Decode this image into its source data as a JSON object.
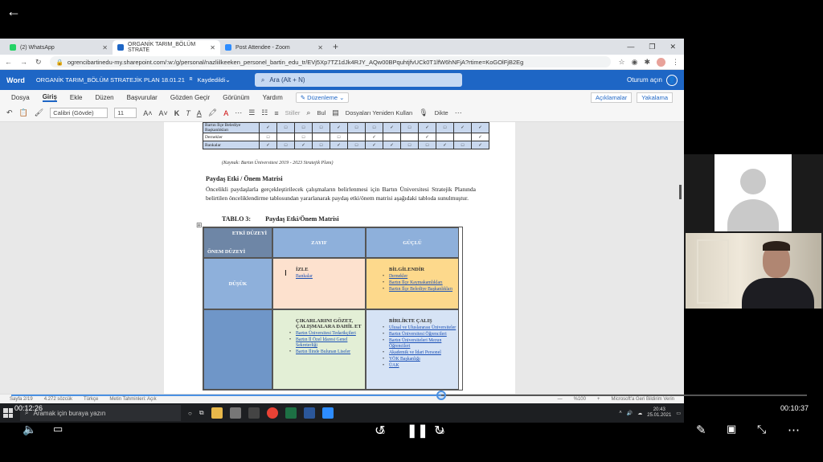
{
  "browser": {
    "tabs": [
      {
        "label": "(2) WhatsApp",
        "color": "#25d366",
        "active": false
      },
      {
        "label": "ORGANİK TARIM_BÖLÜM STRATE",
        "color": "#1e66c5",
        "active": true
      },
      {
        "label": "Post Attendee - Zoom",
        "color": "#2d8cff",
        "active": false
      }
    ],
    "url": "ogrencibartinedu-my.sharepoint.com/:w:/g/personal/nazliilkeeken_personel_bartin_edu_tr/EVj5Xp7TZ1dJk4RJY_AQw00BPquhtjfvUCk0T1lfW6hNFjA?rtime=KoGOlFjB2Eg"
  },
  "word": {
    "app_name": "Word",
    "doc_title": "ORGANİK TARIM_BÖLÜM STRATEJİK PLAN 18.01.21",
    "saved": "Kaydedildi",
    "search_placeholder": "Ara (Alt + N)",
    "signin": "Oturum açın",
    "ribbon_tabs": [
      "Dosya",
      "Giriş",
      "Ekle",
      "Düzen",
      "Başvurular",
      "Gözden Geçir",
      "Görünüm",
      "Yardım"
    ],
    "edit_mode": "Düzenleme",
    "comments": "Açıklamalar",
    "catchup": "Yakalama",
    "font": "Calibri (Gövde)",
    "font_size": "11",
    "styles": "Stiller",
    "find": "Bul",
    "reuse": "Dosyaları Yeniden Kullan",
    "dictate": "Dikte"
  },
  "document": {
    "top_rows": [
      {
        "label": "Bartın İlçe Belediye Başkanlıkları",
        "cells": [
          "✓",
          "□",
          "□",
          "□",
          "✓",
          "□",
          "□",
          "✓",
          "□",
          "✓",
          "□",
          "✓",
          "✓"
        ]
      },
      {
        "label": "Dernekler",
        "cells": [
          "□",
          "",
          "□",
          "",
          "□",
          "",
          "✓",
          "",
          "",
          "✓",
          "",
          "",
          "✓"
        ]
      },
      {
        "label": "Bankalar",
        "cells": [
          "✓",
          "□",
          "✓",
          "□",
          "✓",
          "□",
          "✓",
          "✓",
          "□",
          "□",
          "✓",
          "□",
          "✓"
        ]
      }
    ],
    "caption": "(Kaynak: Bartın Üniversitesi 2019 - 2023 Stratejik Planı)",
    "heading": "Paydaş Etki / Önem Matrisi",
    "paragraph": "Öncelikli paydaşlarla gerçekleştirilecek çalışmaların belirlenmesi için Bartın Üniversitesi Stratejik Planında belirtilen önceliklendirme tablosundan yararlanarak paydaş etki/önem matrisi aşağıdaki tabloda sunulmuştur.",
    "table_no": "TABLO 3:",
    "table_title": "Paydaş Etki/Önem Matrisi",
    "matrix": {
      "corner_top": "ETKİ DÜZEYİ",
      "corner_bottom": "ÖNEM DÜZEYİ",
      "col1": "ZAYIF",
      "col2": "GÜÇLÜ",
      "row1": "DÜŞÜK",
      "q11_title": "İZLE",
      "q11_items": [
        "Bankalar"
      ],
      "q12_title": "BİLGİLENDİR",
      "q12_items": [
        "Dernekler",
        "Bartın İlçe Kaymakamlıkları",
        "Bartın İlçe Belediye Başkanlıkları"
      ],
      "q21_title": "ÇIKARLARINI GÖZET, ÇALIŞMALARA DAHİL ET",
      "q21_items": [
        "Bartın Üniversitesi Tedarikçileri",
        "Bartın İl Özel İdaresi Genel Sekreterliği",
        "Bartın İlinde Bulunan Liseler"
      ],
      "q22_title": "BİRLİKTE ÇALIŞ",
      "q22_items": [
        "Ulusal ve Uluslararası Üniversiteler",
        "Bartın Üniversitesi Öğrencileri",
        "Bartın Üniversiteleri Mezun Öğrencileri",
        "Akademik ve İdari Personel",
        "YÖK Başkanlığı",
        "ÜAK"
      ]
    }
  },
  "statusbar": {
    "page": "Sayfa 2/19",
    "words": "4.272 sözcük",
    "lang": "Türkçe",
    "predict": "Metin Tahminleri: Açık",
    "zoom": "%100",
    "feedback": "Microsoft'a Geri Bildirim Verin"
  },
  "taskbar": {
    "search": "Aramak için buraya yazın",
    "time": "20:43",
    "date": "25.01.2021"
  },
  "player": {
    "elapsed": "00:12:26",
    "remaining": "00:10:37",
    "progress": 0.54,
    "skip_back": "10",
    "skip_fwd": "30"
  }
}
